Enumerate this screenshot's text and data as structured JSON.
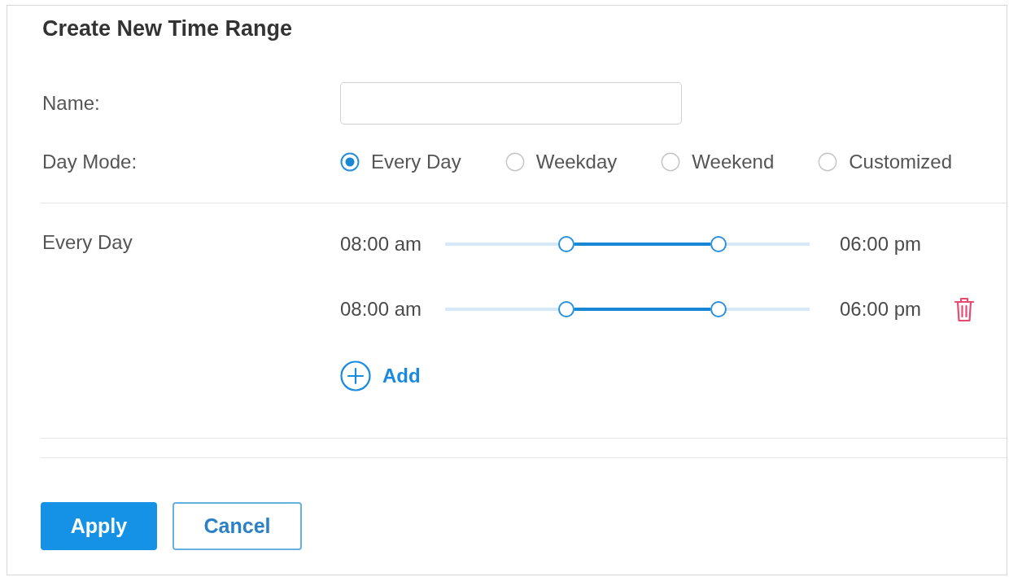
{
  "panel": {
    "title": "Create New Time Range"
  },
  "name_field": {
    "label": "Name:"
  },
  "day_mode": {
    "label": "Day Mode:",
    "options": [
      {
        "label": "Every Day",
        "selected": true
      },
      {
        "label": "Weekday",
        "selected": false
      },
      {
        "label": "Weekend",
        "selected": false
      },
      {
        "label": "Customized",
        "selected": false
      }
    ]
  },
  "schedule": {
    "label": "Every Day",
    "slots": [
      {
        "start": "08:00 am",
        "end": "06:00 pm",
        "handles": [
          {
            "level": 0.333
          },
          {
            "level": 0.75
          }
        ],
        "deletable": false
      },
      {
        "start": "08:00 am",
        "end": "06:00 pm",
        "handles": [
          {
            "level": 0.333
          },
          {
            "level": 0.75
          }
        ],
        "deletable": true
      }
    ],
    "add_button": "Add"
  },
  "buttons": [
    {
      "label": "Apply",
      "kind": "primary"
    },
    {
      "label": "Cancel",
      "kind": "outline"
    }
  ]
}
